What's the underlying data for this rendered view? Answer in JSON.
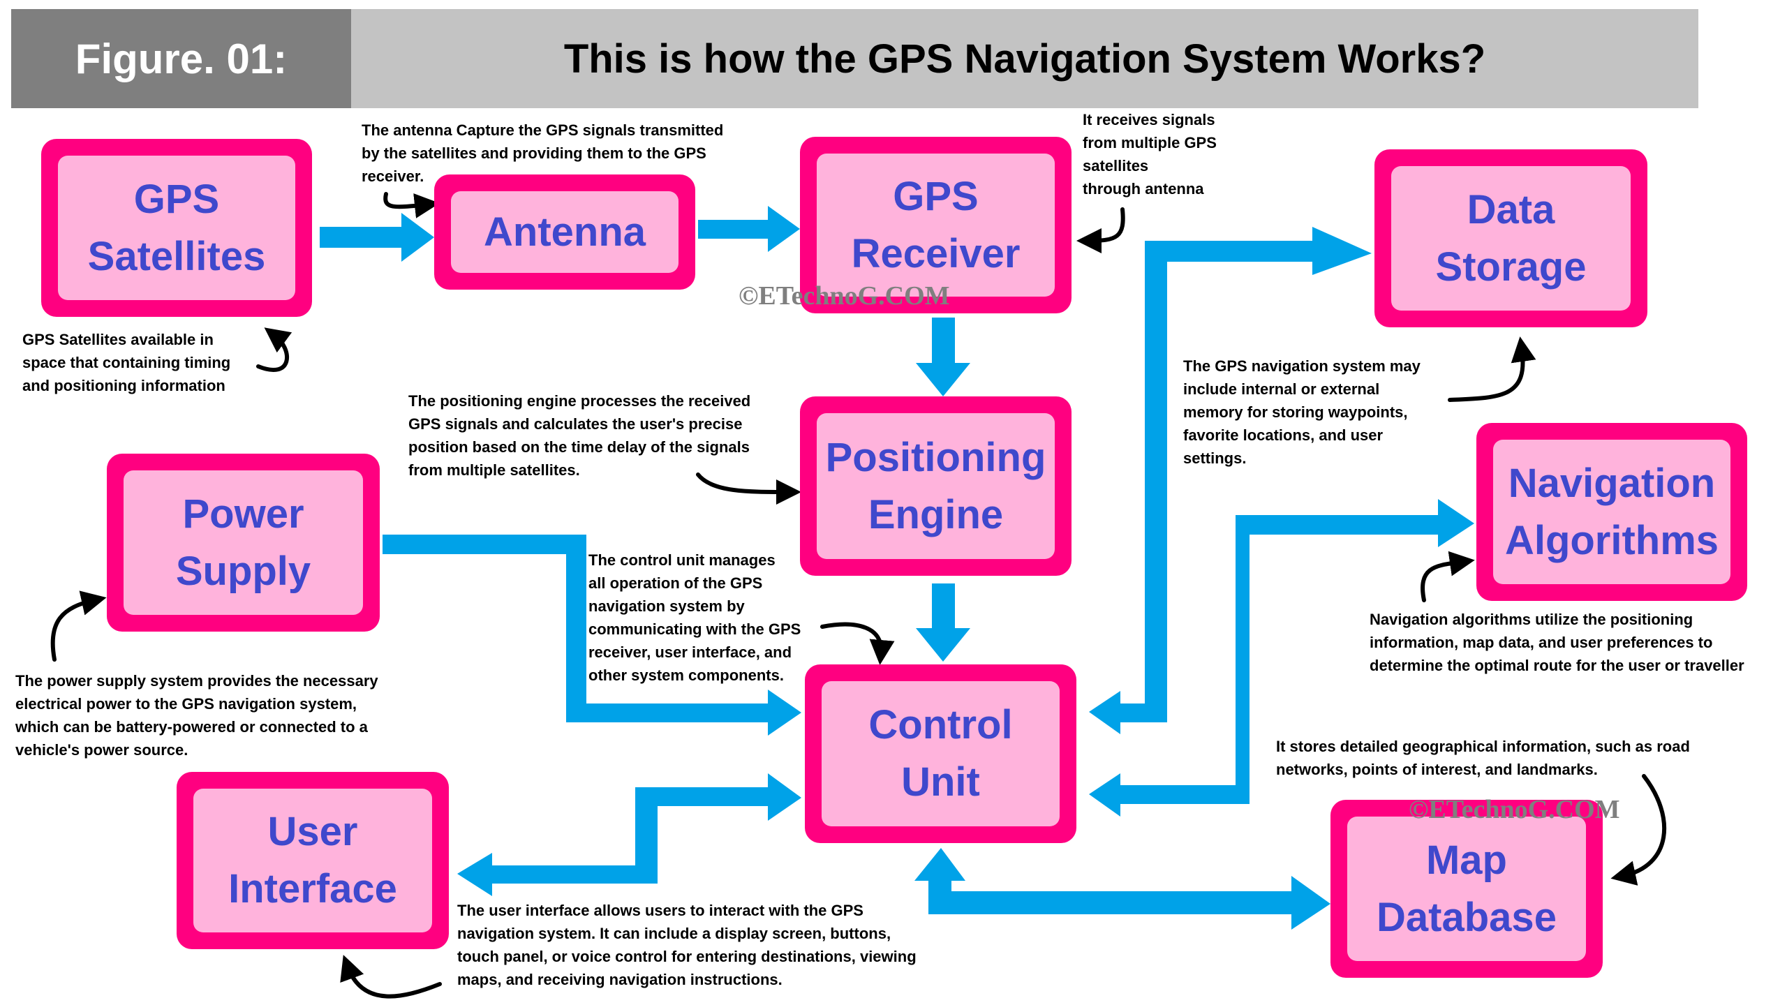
{
  "header": {
    "figure_label": "Figure. 01:",
    "title": "This is how the GPS Navigation System Works?"
  },
  "colors": {
    "box_border": "#ff0080",
    "box_fill": "#ffb3dc",
    "box_text": "#3f48cc",
    "arrow": "#00a2e8",
    "callout": "#000000"
  },
  "blocks": {
    "gps_satellites": "GPS\nSatellites",
    "antenna": "Antenna",
    "gps_receiver": "GPS\nReceiver",
    "data_storage": "Data\nStorage",
    "positioning_engine": "Positioning\nEngine",
    "power_supply": "Power\nSupply",
    "navigation_algorithms": "Navigation\nAlgorithms",
    "control_unit": "Control\nUnit",
    "user_interface": "User\nInterface",
    "map_database": "Map\nDatabase"
  },
  "notes": {
    "antenna": "The antenna Capture the GPS signals transmitted\nby the satellites and providing them to the GPS\nreceiver.",
    "gps_receiver": "It receives signals\nfrom multiple GPS\nsatellites\nthrough antenna",
    "gps_satellites": "GPS Satellites available in\nspace that containing timing\nand positioning information",
    "positioning_engine": "The positioning engine processes the received\nGPS signals and calculates the user's precise\nposition based on the time delay of the signals\nfrom multiple satellites.",
    "data_storage": "The GPS navigation system may\ninclude internal or external\nmemory for storing waypoints,\nfavorite locations, and user\nsettings.",
    "control_unit": "The control unit manages\n all operation of the GPS\nnavigation system by\ncommunicating with the GPS\nreceiver, user interface, and\nother system components.",
    "navigation_algorithms": "Navigation algorithms utilize the positioning\ninformation, map data, and user preferences to\ndetermine the optimal route for the user or traveller",
    "power_supply": "The power supply system provides the necessary\nelectrical power to the GPS navigation system,\nwhich can be battery-powered or connected to a\nvehicle's power source.",
    "map_database": "It stores detailed geographical information, such as road\nnetworks, points of interest, and landmarks.",
    "user_interface": "The user interface allows users to interact with the GPS\nnavigation system. It can include a display screen, buttons,\ntouch panel, or voice control for entering destinations, viewing\nmaps, and receiving navigation instructions."
  },
  "watermarks": [
    "©ETechnoG.COM",
    "©ETechnoG.COM"
  ]
}
